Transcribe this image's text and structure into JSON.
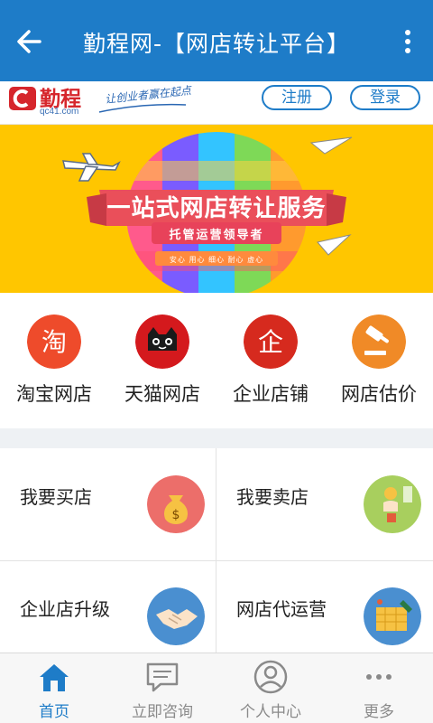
{
  "header": {
    "title": "勤程网-【网店转让平台】",
    "back_icon": "arrow-left-icon",
    "menu_icon": "more-vertical-icon",
    "color": "#1e7cc8"
  },
  "brand": {
    "name": "勤程",
    "url": "qc41.com",
    "slogan": "让创业者赢在起点",
    "register_label": "注册",
    "login_label": "登录"
  },
  "banner": {
    "headline": "一站式网店转让服务",
    "subline": "托管运营领导者",
    "tags": "安心 用心 细心 耐心 虚心",
    "background": "#ffc600"
  },
  "categories": [
    {
      "label": "淘宝网店",
      "icon": "taobao-icon",
      "color": "#ee4b2b",
      "glyph": "淘"
    },
    {
      "label": "天猫网店",
      "icon": "tmall-cat-icon",
      "color": "#d4191d",
      "glyph": ""
    },
    {
      "label": "企业店铺",
      "icon": "enterprise-icon",
      "color": "#d62a1e",
      "glyph": "企"
    },
    {
      "label": "网店估价",
      "icon": "gavel-icon",
      "color": "#f08a27",
      "glyph": ""
    }
  ],
  "services": [
    {
      "label": "我要买店",
      "icon": "money-bag-icon",
      "color": "#ec6e6a"
    },
    {
      "label": "我要卖店",
      "icon": "hand-coin-icon",
      "color": "#a8cf5e"
    },
    {
      "label": "企业店升级",
      "icon": "handshake-icon",
      "color": "#4a8fd0"
    },
    {
      "label": "网店代运营",
      "icon": "operation-calendar-icon",
      "color": "#4a8fd0"
    }
  ],
  "bottom_nav": [
    {
      "label": "首页",
      "icon": "home-icon",
      "active": true
    },
    {
      "label": "立即咨询",
      "icon": "chat-icon",
      "active": false
    },
    {
      "label": "个人中心",
      "icon": "user-icon",
      "active": false
    },
    {
      "label": "更多",
      "icon": "more-horizontal-icon",
      "active": false
    }
  ]
}
